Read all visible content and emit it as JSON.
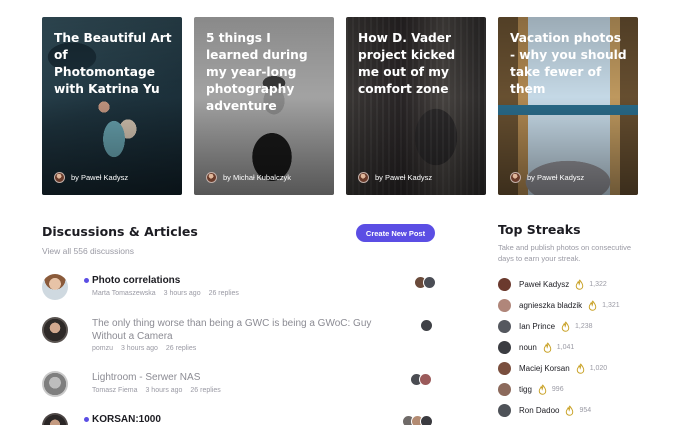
{
  "cards": [
    {
      "title": "The Beautiful Art of Photomontage with Katrina Yu",
      "author": "by Paweł Kadysz"
    },
    {
      "title": "5 things I learned during my year-long photography adventure",
      "author": "by Michał Kubalczyk"
    },
    {
      "title": "How D. Vader project kicked me out of my comfort zone",
      "author": "by Paweł Kadysz"
    },
    {
      "title": "Vacation photos - why you should take fewer of them",
      "author": "by Paweł Kadysz"
    }
  ],
  "discussions": {
    "heading": "Discussions & Articles",
    "subheading": "View all 556 discussions",
    "new_post_label": "Create New Post",
    "threads": [
      {
        "title": "Photo correlations",
        "author": "Marta Tomaszewska",
        "time": "3 hours ago",
        "replies": "26 replies",
        "unread": true
      },
      {
        "title": "The only thing worse than being a GWC is being a GWoC: Guy Without a Camera",
        "author": "pomzu",
        "time": "3 hours ago",
        "replies": "26 replies",
        "unread": false
      },
      {
        "title": "Lightroom - Serwer NAS",
        "author": "Tomasz Fiema",
        "time": "3 hours ago",
        "replies": "26 replies",
        "unread": false
      },
      {
        "title": "KORSAN:1000",
        "author": "",
        "time": "",
        "replies": "",
        "unread": true
      }
    ]
  },
  "streaks": {
    "heading": "Top Streaks",
    "description": "Take and publish photos on consecutive days to earn your streak.",
    "users": [
      {
        "name": "Paweł Kadysz",
        "count": "1,322"
      },
      {
        "name": "agnieszka bladzik",
        "count": "1,321"
      },
      {
        "name": "Ian Prince",
        "count": "1,238"
      },
      {
        "name": "noun",
        "count": "1,041"
      },
      {
        "name": "Maciej Korsan",
        "count": "1,020"
      },
      {
        "name": "tigg",
        "count": "996"
      },
      {
        "name": "Ron Dadoo",
        "count": "954"
      }
    ]
  },
  "colors": {
    "accent": "#5b4ee4",
    "streak_icon": "#c9a227"
  },
  "icons": {
    "streak": "flame-icon"
  }
}
